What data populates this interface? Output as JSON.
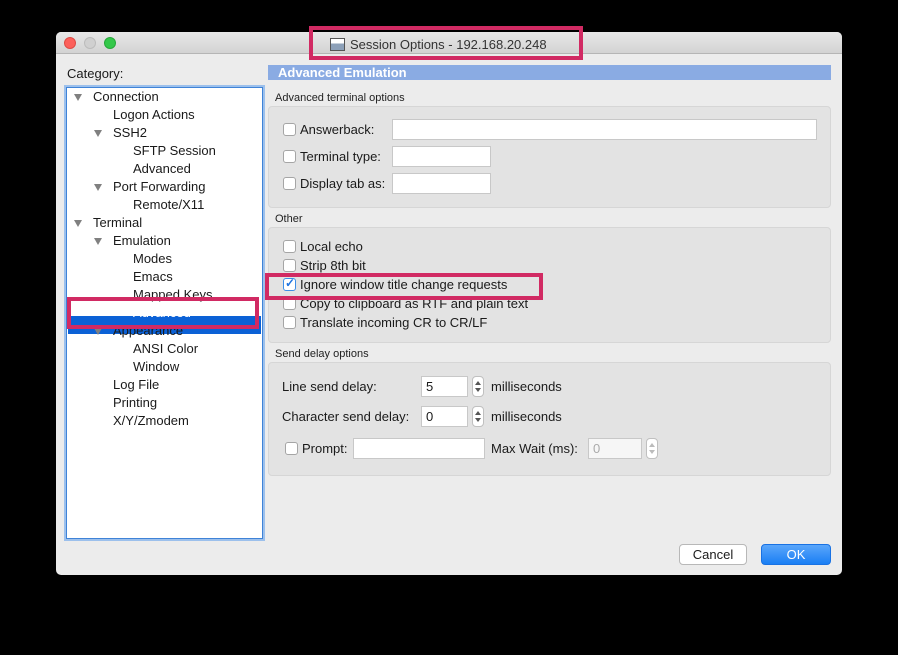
{
  "window": {
    "title": "Session Options - 192.168.20.248"
  },
  "category_label": "Category:",
  "tree": [
    {
      "label": "Connection",
      "expanded": true
    },
    {
      "label": "Logon Actions"
    },
    {
      "label": "SSH2",
      "expanded": true
    },
    {
      "label": "SFTP Session"
    },
    {
      "label": "Advanced"
    },
    {
      "label": "Port Forwarding",
      "expanded": true
    },
    {
      "label": "Remote/X11"
    },
    {
      "label": "Terminal",
      "expanded": true
    },
    {
      "label": "Emulation",
      "expanded": true
    },
    {
      "label": "Modes"
    },
    {
      "label": "Emacs"
    },
    {
      "label": "Mapped Keys"
    },
    {
      "label": "Advanced",
      "selected": true
    },
    {
      "label": "Appearance",
      "expanded": true
    },
    {
      "label": "ANSI Color"
    },
    {
      "label": "Window"
    },
    {
      "label": "Log File"
    },
    {
      "label": "Printing"
    },
    {
      "label": "X/Y/Zmodem"
    }
  ],
  "panel": {
    "header": "Advanced Emulation",
    "terminal_group": {
      "label": "Advanced terminal options",
      "answerback": {
        "label": "Answerback:",
        "checked": false,
        "value": ""
      },
      "terminal_type": {
        "label": "Terminal type:",
        "checked": false,
        "value": ""
      },
      "display_tab": {
        "label": "Display tab as:",
        "checked": false,
        "value": ""
      }
    },
    "other_group": {
      "label": "Other",
      "options": [
        {
          "label": "Local echo",
          "checked": false
        },
        {
          "label": "Strip 8th bit",
          "checked": false
        },
        {
          "label": "Ignore window title change requests",
          "checked": true
        },
        {
          "label": "Copy to clipboard as RTF and plain text",
          "checked": false
        },
        {
          "label": "Translate incoming CR to CR/LF",
          "checked": false
        }
      ]
    },
    "send_delay_group": {
      "label": "Send delay options",
      "line_delay": {
        "label": "Line send delay:",
        "value": "5",
        "unit": "milliseconds"
      },
      "char_delay": {
        "label": "Character send delay:",
        "value": "0",
        "unit": "milliseconds"
      },
      "prompt": {
        "label": "Prompt:",
        "checked": false,
        "value": ""
      },
      "max_wait": {
        "label": "Max Wait (ms):",
        "value": "0"
      }
    }
  },
  "buttons": {
    "cancel": "Cancel",
    "ok": "OK"
  },
  "colors": {
    "highlight": "#d12a63",
    "selection": "#0b61d6",
    "header": "#8aabe3",
    "primary_button": "#1a7ff4"
  }
}
